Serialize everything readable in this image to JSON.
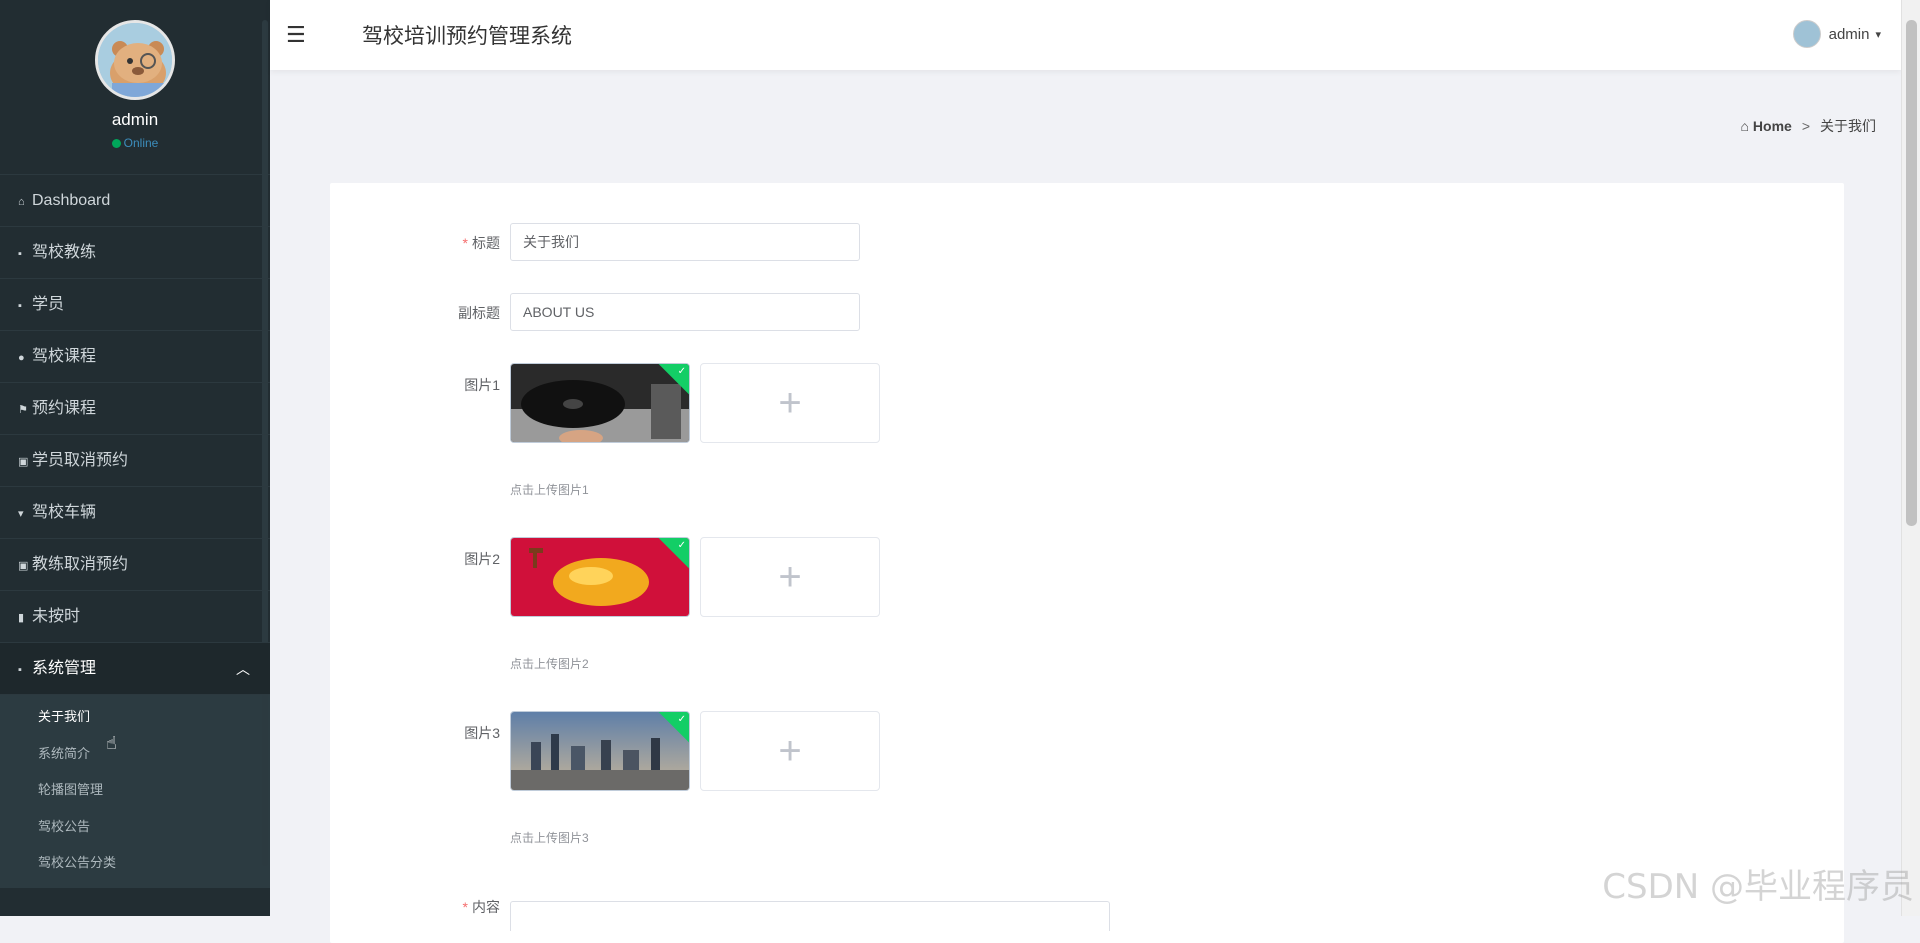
{
  "sidebar": {
    "username": "admin",
    "status": "Online",
    "menu": [
      {
        "label": "Dashboard",
        "icon": "home-icon"
      },
      {
        "label": "驾校教练",
        "icon": "grid-icon"
      },
      {
        "label": "学员",
        "icon": "grid-icon"
      },
      {
        "label": "驾校课程",
        "icon": "user-icon"
      },
      {
        "label": "预约课程",
        "icon": "flag-icon"
      },
      {
        "label": "学员取消预约",
        "icon": "clipboard-icon"
      },
      {
        "label": "驾校车辆",
        "icon": "pin-icon"
      },
      {
        "label": "教练取消预约",
        "icon": "clipboard-icon"
      },
      {
        "label": "未按时",
        "icon": "bar-chart-icon"
      },
      {
        "label": "系统管理",
        "icon": "grid-icon",
        "open": true
      }
    ],
    "submenu": [
      {
        "label": "关于我们",
        "active": true
      },
      {
        "label": "系统简介"
      },
      {
        "label": "轮播图管理"
      },
      {
        "label": "驾校公告"
      },
      {
        "label": "驾校公告分类"
      }
    ]
  },
  "topbar": {
    "title": "驾校培训预约管理系统",
    "user": "admin"
  },
  "breadcrumb": {
    "home": "Home",
    "current": "关于我们"
  },
  "form": {
    "title_label": "标题",
    "title_value": "关于我们",
    "subtitle_label": "副标题",
    "subtitle_value": "ABOUT US",
    "image1_label": "图片1",
    "image1_hint": "点击上传图片1",
    "image2_label": "图片2",
    "image2_hint": "点击上传图片2",
    "image3_label": "图片3",
    "image3_hint": "点击上传图片3",
    "content_label": "内容",
    "upload_plus": "+"
  },
  "watermark": "CSDN @毕业程序员",
  "colors": {
    "sidebar_bg": "#222d32",
    "online_dot": "#00a65a",
    "required": "#f56c6c",
    "upload_success": "#13ce66"
  }
}
